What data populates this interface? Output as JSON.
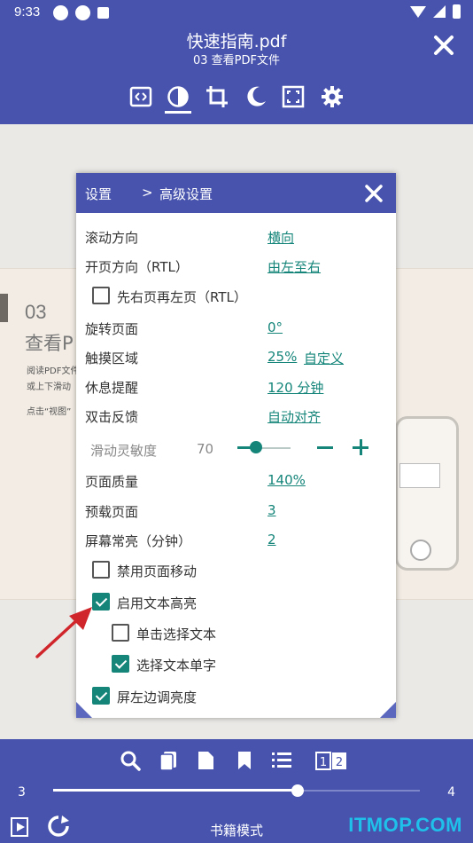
{
  "status_bar": {
    "time": "9:33",
    "icons": [
      "gear-icon",
      "gear-icon",
      "a-icon"
    ],
    "right_icons": [
      "wifi-icon",
      "signal-icon",
      "battery-icon"
    ]
  },
  "header": {
    "title": "快速指南.pdf",
    "subtitle": "03 查看PDF文件",
    "toolbar": [
      "fit-width-icon",
      "contrast-icon",
      "crop-icon",
      "night-mode-icon",
      "fullscreen-icon",
      "settings-icon"
    ],
    "active_tool": "contrast-icon"
  },
  "page": {
    "number": "03",
    "heading": "查看P",
    "para1": "阅读PDF文件",
    "para2": "或上下滑动",
    "para3": "点击“视图”"
  },
  "dialog": {
    "breadcrumb_root": "设置",
    "breadcrumb_sep": ">",
    "breadcrumb_current": "高级设置",
    "rows": [
      {
        "label": "滚动方向",
        "value": "横向"
      },
      {
        "label": "开页方向（RTL）",
        "value": "由左至右"
      },
      {
        "label": "旋转页面",
        "value": "0°"
      },
      {
        "label": "触摸区域",
        "value": "25%",
        "value2": "自定义"
      },
      {
        "label": "休息提醒",
        "value": "120 分钟"
      },
      {
        "label": "双击反馈",
        "value": "自动对齐"
      },
      {
        "label": "页面质量",
        "value": "140%"
      },
      {
        "label": "预载页面",
        "value": "3"
      },
      {
        "label": "屏幕常亮（分钟）",
        "value": "2"
      }
    ],
    "checkboxes": [
      {
        "label": "先右页再左页（RTL）",
        "checked": false
      },
      {
        "label": "禁用页面移动",
        "checked": false
      },
      {
        "label": "启用文本高亮",
        "checked": true
      },
      {
        "label": "单击选择文本",
        "checked": false
      },
      {
        "label": "选择文本单字",
        "checked": true
      },
      {
        "label": "屏左边调亮度",
        "checked": true
      }
    ],
    "slider": {
      "label": "滑动灵敏度",
      "value": "70",
      "fraction": 0.35
    }
  },
  "bottom": {
    "tools": [
      "search-icon",
      "copy-icon",
      "page-icon",
      "bookmark-icon",
      "list-icon",
      "two-page-icon"
    ],
    "progress": {
      "start": "3",
      "end": "4",
      "fraction": 0.666
    },
    "mode_label": "书籍模式",
    "left_icons": [
      "play-icon",
      "refresh-icon"
    ],
    "watermark": "ITMOP.COM"
  },
  "colors": {
    "primary": "#4753ad",
    "accent": "#15857a",
    "arrow": "#d0262b"
  }
}
